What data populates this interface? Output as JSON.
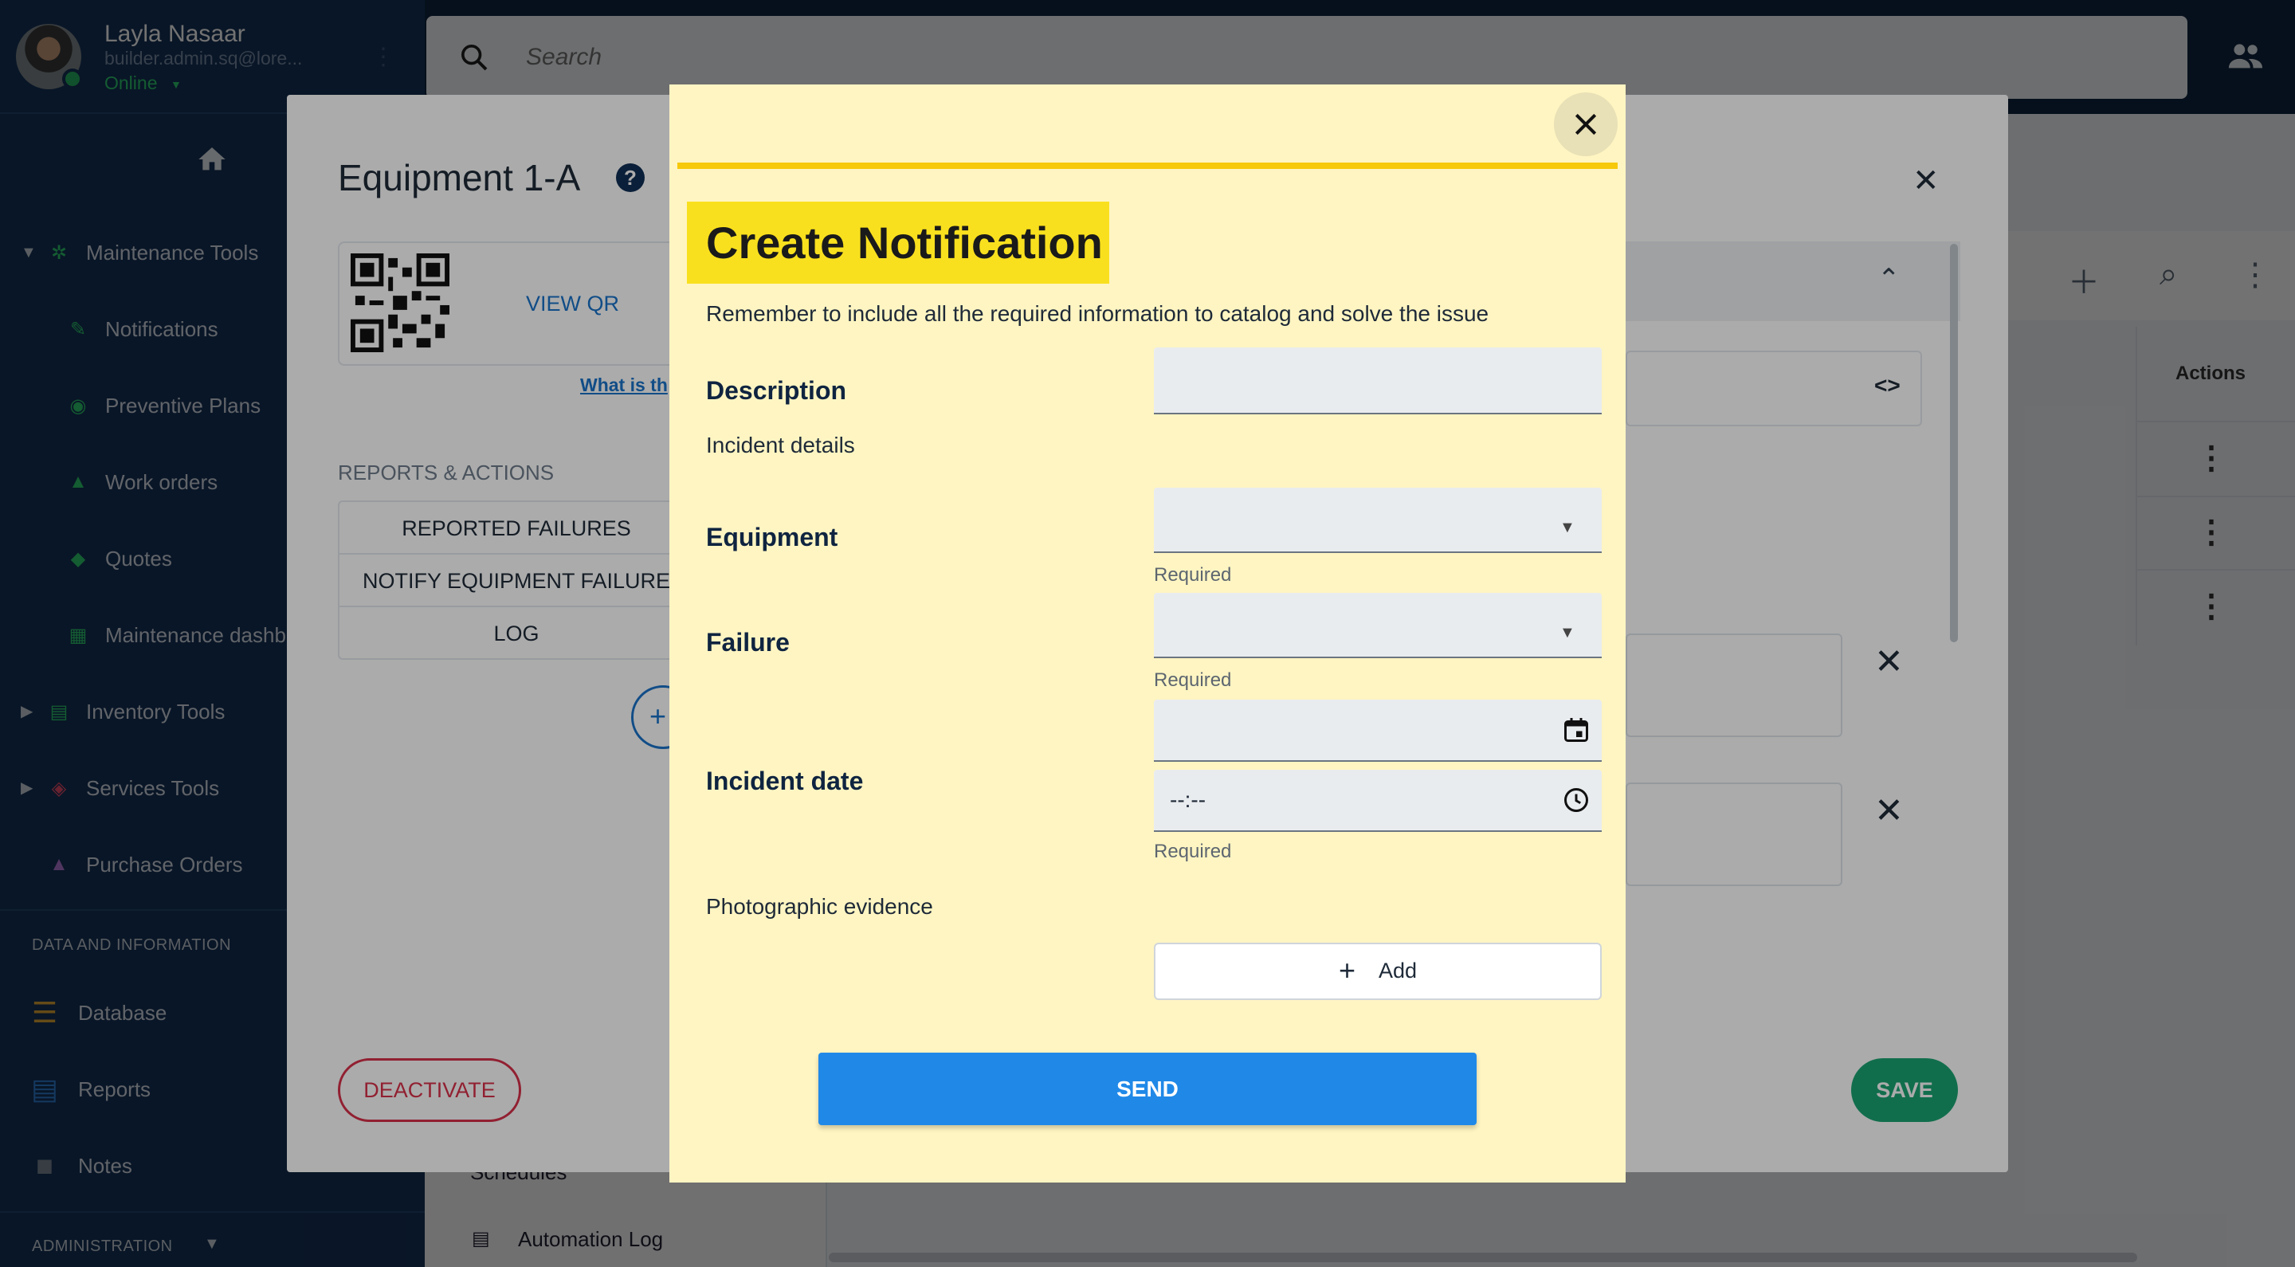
{
  "user": {
    "name": "Layla Nasaar",
    "email": "builder.admin.sq@lore...",
    "status": "Online"
  },
  "search": {
    "placeholder": "Search"
  },
  "sidebar": {
    "groups": [
      {
        "label": "Maintenance Tools",
        "icon": "gear-icon",
        "color": "#2ecc71"
      },
      {
        "label": "Inventory Tools",
        "icon": "archive-icon",
        "color": "#2ecc71"
      },
      {
        "label": "Services Tools",
        "icon": "thumbs-up-icon",
        "color": "#e74c6c"
      },
      {
        "label": "Purchase Orders",
        "icon": "flask-icon",
        "color": "#b17ad6"
      }
    ],
    "maintenance_items": [
      {
        "label": "Notifications",
        "icon": "wrench-icon"
      },
      {
        "label": "Preventive Plans",
        "icon": "target-icon"
      },
      {
        "label": "Work orders",
        "icon": "hardhat-icon"
      },
      {
        "label": "Quotes",
        "icon": "tag-icon"
      },
      {
        "label": "Maintenance dashboard",
        "icon": "dashboard-icon"
      }
    ],
    "data_section": "DATA AND INFORMATION",
    "data_items": [
      {
        "label": "Database",
        "icon": "database-icon",
        "color": "#e1a835"
      },
      {
        "label": "Reports",
        "icon": "report-icon",
        "color": "#2d7fd6"
      },
      {
        "label": "Notes",
        "icon": "folder-icon",
        "color": "#7c8896"
      }
    ],
    "admin_section": "ADMINISTRATION"
  },
  "background": {
    "nav": [
      "Schedules",
      "Automation Log"
    ],
    "actions_header": "Actions"
  },
  "equipment_dialog": {
    "title": "Equipment 1-A",
    "view_qr": "VIEW QR",
    "what_is": "What is th",
    "reports_label": "REPORTS & ACTIONS",
    "actions": [
      "REPORTED FAILURES",
      "NOTIFY EQUIPMENT FAILURE",
      "LOG"
    ],
    "deactivate": "DEACTIVATE",
    "save": "SAVE"
  },
  "modal": {
    "title": "Create Notification",
    "subtitle": "Remember to include all the required information to catalog and solve the issue",
    "description_label": "Description",
    "incident_details": "Incident details",
    "equipment_label": "Equipment",
    "failure_label": "Failure",
    "incident_date_label": "Incident date",
    "required": "Required",
    "time_value": "--:--",
    "photo_label": "Photographic evidence",
    "add_label": "Add",
    "send": "SEND",
    "accent": "#f6c90a"
  }
}
